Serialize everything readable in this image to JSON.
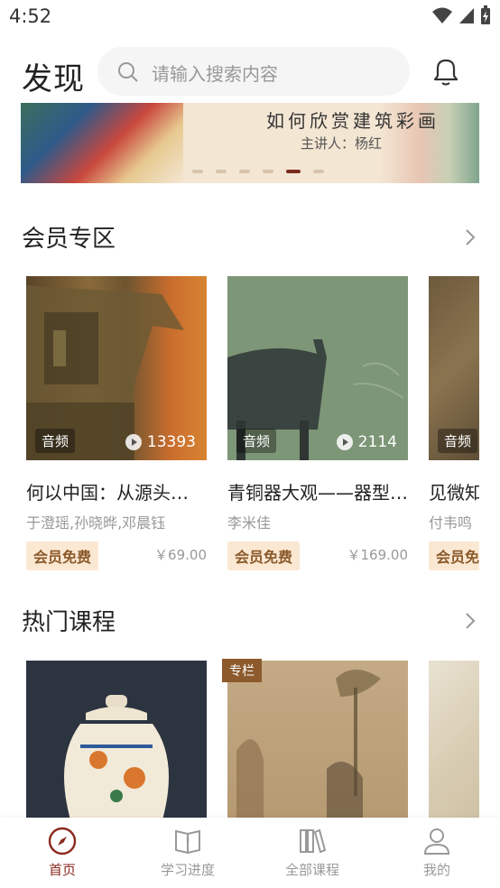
{
  "status_bar": {
    "time": "4:52"
  },
  "header": {
    "title": "发现",
    "search_placeholder": "请输入搜索内容"
  },
  "banner": {
    "title": "如何欣赏建筑彩画",
    "subtitle": "主讲人：杨红",
    "dot_count": 6,
    "active_dot_index": 4
  },
  "member_section": {
    "title": "会员专区",
    "cards": [
      {
        "type": "音频",
        "plays": "13393",
        "title": "何以中国：从源头…",
        "authors": "于澄瑶,孙晓晔,邓晨钰",
        "badge": "会员免费",
        "price": "￥69.00"
      },
      {
        "type": "音频",
        "plays": "2114",
        "title": "青铜器大观——器型…",
        "authors": "李米佳",
        "badge": "会员免费",
        "price": "￥169.00"
      },
      {
        "type": "音频",
        "title": "见微知",
        "authors": "付韦鸣",
        "badge": "会员免"
      }
    ]
  },
  "hot_section": {
    "title": "热门课程",
    "cards": [
      {
        "tag": ""
      },
      {
        "tag": "专栏"
      },
      {
        "tag": ""
      }
    ]
  },
  "bottom_nav": [
    {
      "label": "首页",
      "icon": "compass-icon",
      "active": true
    },
    {
      "label": "学习进度",
      "icon": "book-icon",
      "active": false
    },
    {
      "label": "全部课程",
      "icon": "library-icon",
      "active": false
    },
    {
      "label": "我的",
      "icon": "person-icon",
      "active": false
    }
  ],
  "colors": {
    "accent": "#8b2a1f",
    "badge_bg": "#fbe8d3",
    "badge_text": "#8a5a2b"
  }
}
